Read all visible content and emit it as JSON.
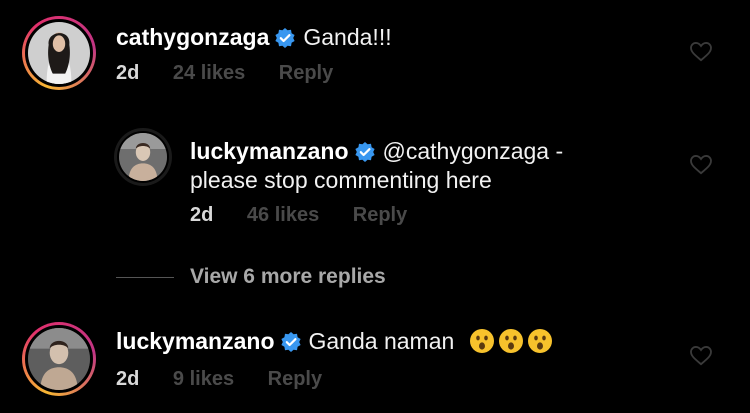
{
  "comments": [
    {
      "username": "cathygonzaga",
      "text": "Ganda!!!",
      "time": "2d",
      "likes": "24 likes",
      "reply": "Reply",
      "avatar_icon": "profile-photo-cathygonzaga",
      "verified_icon": "verified-badge-icon"
    },
    {
      "username": "luckymanzano",
      "text": "@cathygonzaga -",
      "text_line2": "please stop commenting here",
      "time": "2d",
      "likes": "46 likes",
      "reply": "Reply",
      "avatar_icon": "profile-photo-luckymanzano",
      "verified_icon": "verified-badge-icon"
    },
    {
      "username": "luckymanzano",
      "text": "Ganda naman",
      "emojis": [
        "astonished-face",
        "astonished-face",
        "astonished-face"
      ],
      "time": "2d",
      "likes": "9 likes",
      "reply": "Reply",
      "avatar_icon": "profile-photo-luckymanzano",
      "verified_icon": "verified-badge-icon"
    }
  ],
  "view_more": {
    "label": "View 6 more replies"
  },
  "colors": {
    "background": "#000000",
    "verified": "#3897f0",
    "muted": "#4a4a4a"
  }
}
